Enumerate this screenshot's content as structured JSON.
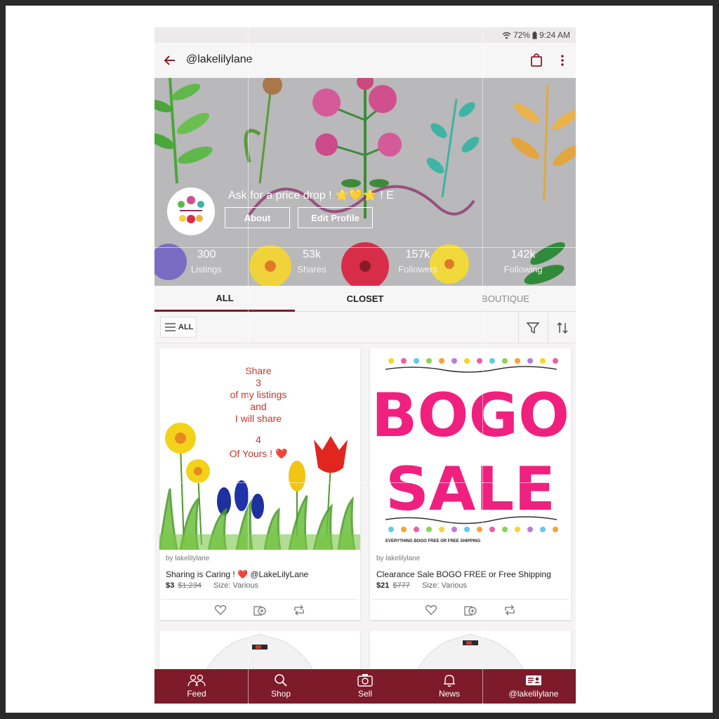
{
  "status_bar": {
    "battery": "72%",
    "time": "9:24 AM"
  },
  "app_bar": {
    "handle": "@lakelilylane"
  },
  "profile": {
    "tagline": "Ask for a price drop ! ⭐💛⭐ ! E",
    "about_label": "About",
    "edit_label": "Edit Profile",
    "stats": [
      {
        "value": "300",
        "label": "Listings"
      },
      {
        "value": "53k",
        "label": "Shares"
      },
      {
        "value": "157k",
        "label": "Followers"
      },
      {
        "value": "142k",
        "label": "Following"
      }
    ]
  },
  "tabs": [
    {
      "label": "ALL"
    },
    {
      "label": "CLOSET"
    },
    {
      "label": "BOUTIQUE"
    }
  ],
  "filter": {
    "all_label": "ALL"
  },
  "listings": [
    {
      "image_text": [
        "Share",
        "3",
        "of my listings",
        "and",
        "I will share",
        "4",
        "Of Yours ! ❤️"
      ],
      "by": "by lakelilylane",
      "title": "Sharing is Caring ! ❤️ @LakeLilyLane",
      "price": "$3",
      "original_price": "$1,234",
      "size": "Size: Various"
    },
    {
      "image_text": [
        "BOGO",
        "SALE",
        "EVERYTHING BOGO FREE OR FREE SHIPPING"
      ],
      "by": "by lakelilylane",
      "title": "Clearance Sale BOGO FREE or Free Shipping",
      "price": "$21",
      "original_price": "$777",
      "size": "Size: Various"
    }
  ],
  "nav": [
    {
      "label": "Feed",
      "icon": "feed-icon"
    },
    {
      "label": "Shop",
      "icon": "search-icon"
    },
    {
      "label": "Sell",
      "icon": "camera-icon"
    },
    {
      "label": "News",
      "icon": "bell-icon"
    },
    {
      "label": "@lakelilylane",
      "icon": "profile-card-icon"
    }
  ],
  "colors": {
    "brand": "#7d1b2b",
    "bogo_pink": "#f0207f"
  }
}
